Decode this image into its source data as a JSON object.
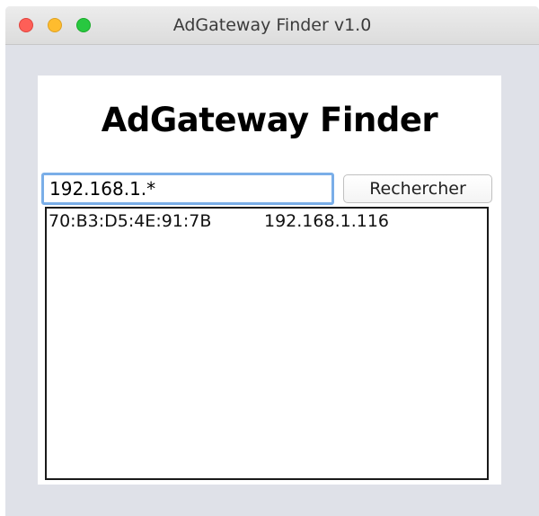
{
  "window": {
    "title": "AdGateway Finder v1.0"
  },
  "app": {
    "heading": "AdGateway Finder"
  },
  "search": {
    "value": "192.168.1.*",
    "button_label": "Rechercher"
  },
  "results": [
    {
      "mac": "70:B3:D5:4E:91:7B",
      "ip": "192.168.1.116"
    }
  ]
}
